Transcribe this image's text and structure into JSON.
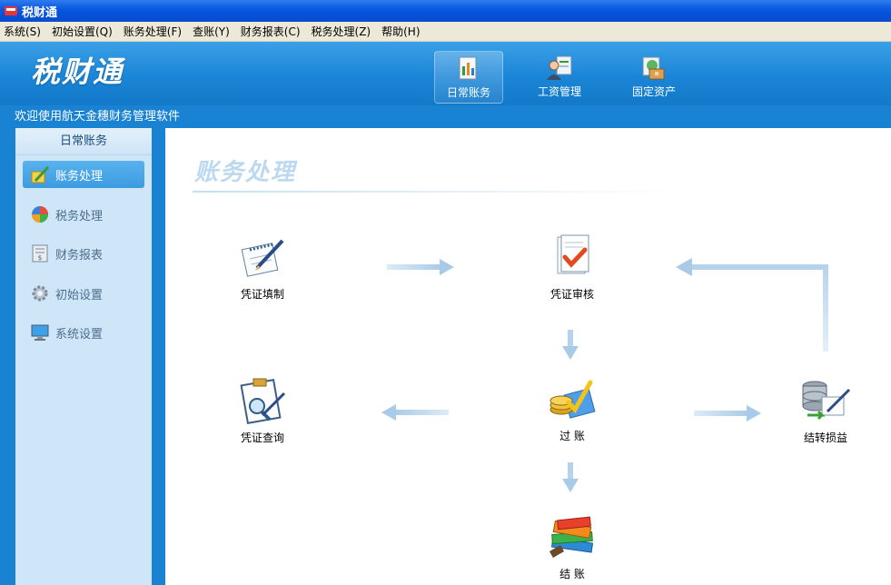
{
  "window": {
    "title": "税财通"
  },
  "menubar": {
    "items": [
      "系统(S)",
      "初始设置(Q)",
      "账务处理(F)",
      "查账(Y)",
      "财务报表(C)",
      "税务处理(Z)",
      "帮助(H)"
    ]
  },
  "header": {
    "logo_text": "税财通",
    "tabs": [
      {
        "label": "日常账务",
        "icon": "ledger-icon",
        "active": true
      },
      {
        "label": "工资管理",
        "icon": "payroll-person-icon",
        "active": false
      },
      {
        "label": "固定资产",
        "icon": "fixed-asset-icon",
        "active": false
      }
    ]
  },
  "welcome_text": "欢迎使用航天金穗财务管理软件",
  "sidebar": {
    "title": "日常账务",
    "items": [
      {
        "label": "账务处理",
        "icon": "pencil-ledger-icon",
        "active": true
      },
      {
        "label": "税务处理",
        "icon": "pie-chart-icon",
        "active": false
      },
      {
        "label": "财务报表",
        "icon": "report-icon",
        "active": false
      },
      {
        "label": "初始设置",
        "icon": "gear-icon",
        "active": false
      },
      {
        "label": "系统设置",
        "icon": "monitor-icon",
        "active": false
      }
    ]
  },
  "main": {
    "section_title": "账务处理",
    "flow": {
      "voucher_entry": "凭证填制",
      "voucher_audit": "凭证审核",
      "posting": "过  账",
      "voucher_query": "凭证查询",
      "profit_transfer": "结转损益",
      "closing": "结  账"
    }
  },
  "colors": {
    "titlebar": "#0a5ae0",
    "header": "#1b85d6",
    "sidebar_bg": "#cfe5f8",
    "active_item": "#3b9be0",
    "arrow": "#b5d3ec"
  }
}
